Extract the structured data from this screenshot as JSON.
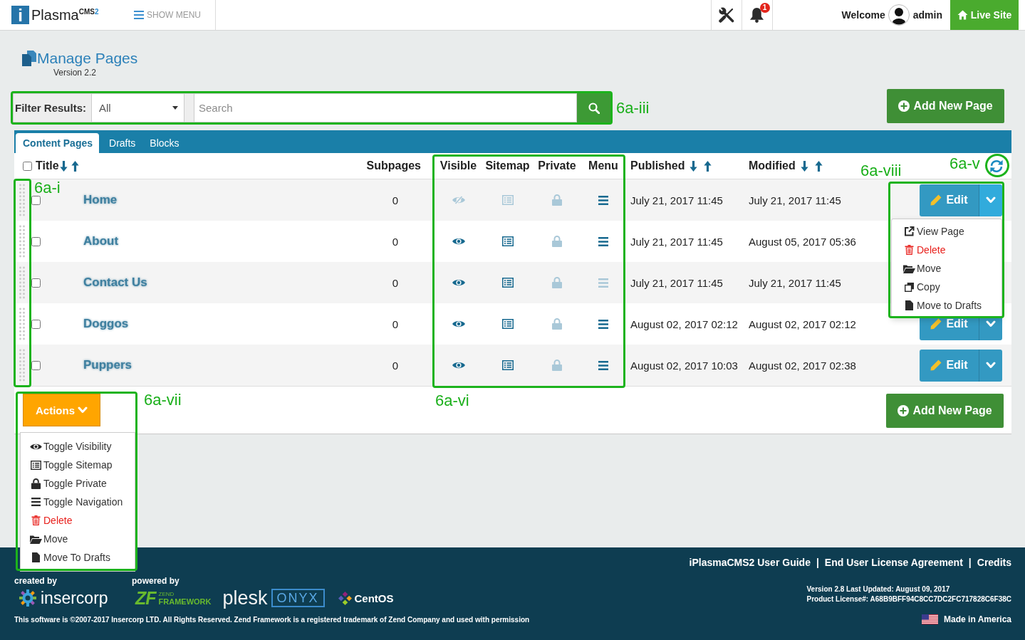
{
  "header": {
    "brand": {
      "mark": "i",
      "name": "Plasma",
      "sup": "CMS",
      "version": "2"
    },
    "menu_toggle": "SHOW MENU",
    "notifications": {
      "count": "1"
    },
    "welcome": "Welcome",
    "user": "admin",
    "live_site": "Live Site"
  },
  "page": {
    "title": "Manage Pages",
    "version": "Version 2.2"
  },
  "filter": {
    "label": "Filter Results:",
    "select": "All",
    "search": {
      "placeholder": "Search"
    },
    "annotation": "6a-iii"
  },
  "add_button_top": "Add New Page",
  "tabs": [
    {
      "label": "Content Pages",
      "selected": true
    },
    {
      "label": "Drafts",
      "selected": false
    },
    {
      "label": "Blocks",
      "selected": false
    }
  ],
  "table": {
    "select_all": {
      "checked": false
    },
    "columns": [
      {
        "label": "Title",
        "kind": "title",
        "sortable": true
      },
      {
        "label": "Subpages",
        "kind": "count",
        "sortable": false
      },
      {
        "label": "Visible",
        "kind": "flag",
        "sortable": false
      },
      {
        "label": "Sitemap",
        "kind": "flag",
        "sortable": false
      },
      {
        "label": "Private",
        "kind": "flag",
        "sortable": false
      },
      {
        "label": "Menu",
        "kind": "flag",
        "sortable": false
      },
      {
        "label": "Published",
        "kind": "date",
        "sortable": true
      },
      {
        "label": "Modified",
        "kind": "date",
        "sortable": true
      }
    ],
    "rows": [
      {
        "title": "Home",
        "checked": false,
        "subpages": "0",
        "visible": false,
        "sitemap": false,
        "private": false,
        "menu": true,
        "published": "July 21, 2017 11:45",
        "modified": "July 21, 2017 11:45",
        "edit": "Edit",
        "expanded": true
      },
      {
        "title": "About",
        "checked": false,
        "subpages": "0",
        "visible": true,
        "sitemap": true,
        "private": false,
        "menu": true,
        "published": "July 21, 2017 11:45",
        "modified": "August 05, 2017 05:36",
        "expanded": false
      },
      {
        "title": "Contact Us",
        "checked": false,
        "subpages": "0",
        "visible": true,
        "sitemap": true,
        "private": false,
        "menu": false,
        "published": "July 21, 2017 11:45",
        "modified": "July 21, 2017 11:45",
        "expanded": false
      },
      {
        "title": "Doggos",
        "checked": false,
        "subpages": "0",
        "visible": true,
        "sitemap": true,
        "private": false,
        "menu": true,
        "published": "August 02, 2017 02:12",
        "modified": "August 02, 2017 02:12",
        "edit": "Edit",
        "expanded": false
      },
      {
        "title": "Puppers",
        "checked": false,
        "subpages": "0",
        "visible": true,
        "sitemap": true,
        "private": false,
        "menu": true,
        "published": "August 02, 2017 10:03",
        "modified": "August 02, 2017 02:38",
        "edit": "Edit",
        "expanded": false
      }
    ],
    "edit_menu": {
      "items": [
        {
          "label": "View Page",
          "kind": "view"
        },
        {
          "label": "Delete",
          "kind": "delete"
        },
        {
          "label": "Move",
          "kind": "move"
        },
        {
          "label": "Copy",
          "kind": "copy"
        },
        {
          "label": "Move to Drafts",
          "kind": "drafts"
        }
      ],
      "annotation": "6a-viii"
    },
    "handle_annotation": "6a-i",
    "flags_annotation": "6a-vi",
    "refresh_annotation": "6a-v"
  },
  "bulk_actions": {
    "label": "Actions",
    "expanded": true,
    "items": [
      {
        "label": "Toggle Visibility",
        "kind": "visibility"
      },
      {
        "label": "Toggle Sitemap",
        "kind": "sitemap"
      },
      {
        "label": "Toggle Private",
        "kind": "private"
      },
      {
        "label": "Toggle Navigation",
        "kind": "navigation"
      },
      {
        "label": "Delete",
        "kind": "delete"
      },
      {
        "label": "Move",
        "kind": "move"
      },
      {
        "label": "Move To Drafts",
        "kind": "drafts"
      }
    ],
    "annotation": "6a-vii"
  },
  "add_button_bottom": "Add New Page",
  "footer": {
    "links": [
      {
        "label": "iPlasmaCMS2 User Guide",
        "separator": "|"
      },
      {
        "label": "End User License Agreement",
        "separator": "|"
      },
      {
        "label": "Credits"
      }
    ],
    "created_by": {
      "label": "created by",
      "brand": "insercorp"
    },
    "powered_by": {
      "label": "powered by",
      "zend": {
        "mark": "ZF",
        "top": "ZEND",
        "bottom": "FRAMEWORK"
      },
      "plesk": {
        "name": "plesk",
        "edition": "ONYX"
      },
      "centos": "CentOS"
    },
    "version": "Version 2.8 Last Updated: August 09, 2017",
    "license": "Product License#: A68B9BFF94C8CC7DC2FC717828C6F38C",
    "copyright": "This software is ©2007-2017 Insercorp LTD. All Rights Reserved. Zend Framework is a registered trademark of Zend Company and used with permission",
    "made_in": "Made in America"
  }
}
